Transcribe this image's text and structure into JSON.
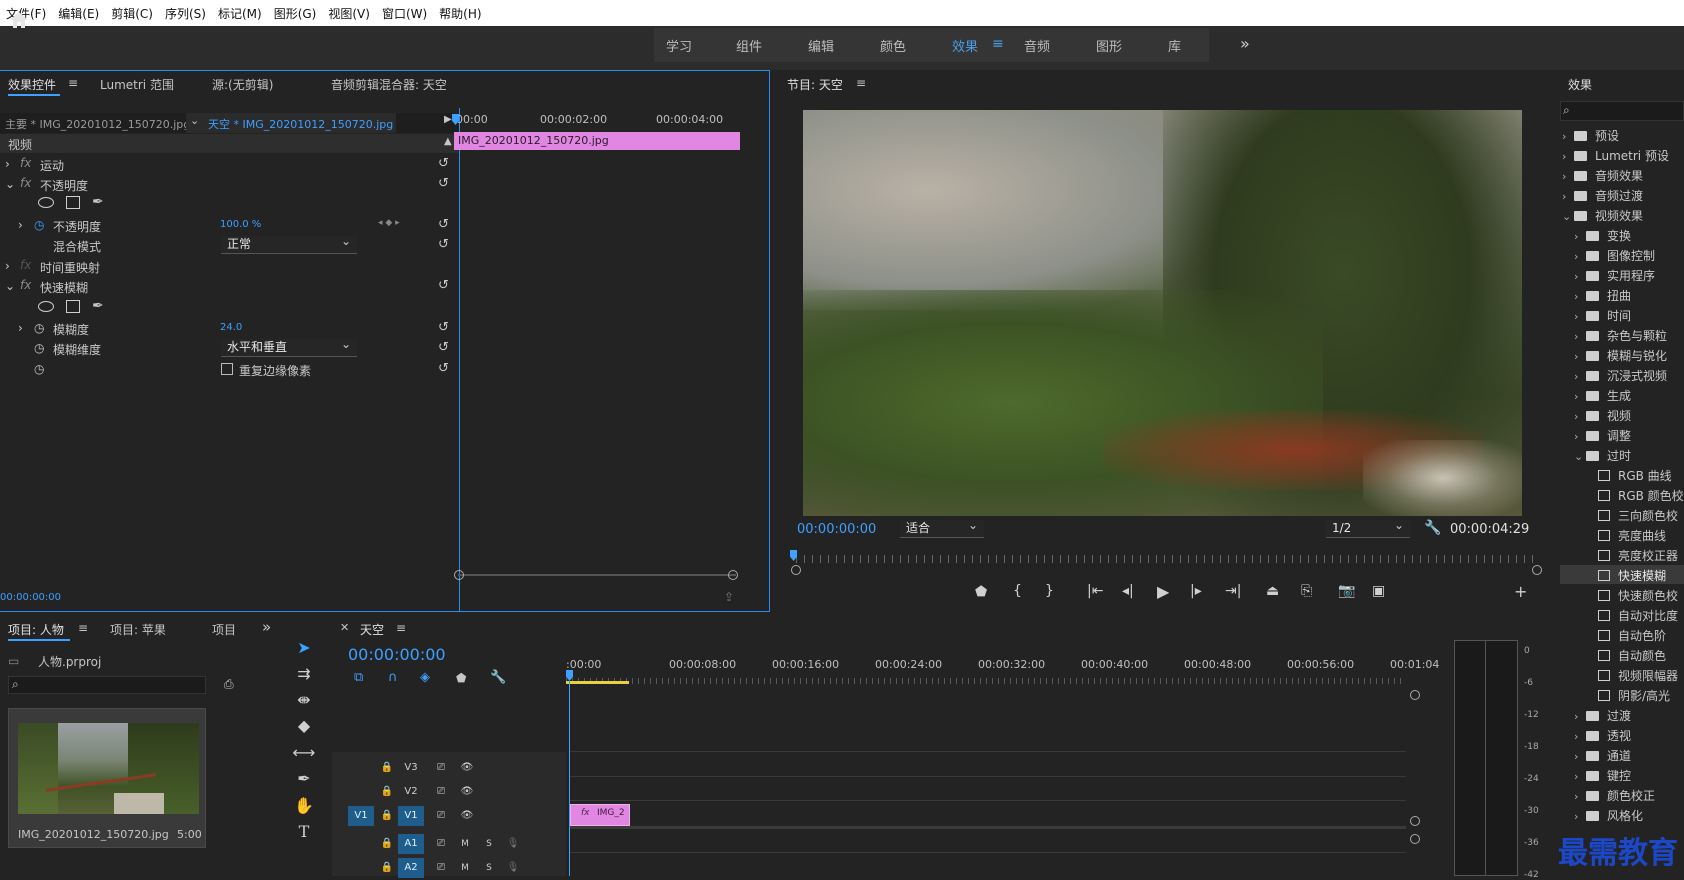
{
  "menu": [
    "文件(F)",
    "编辑(E)",
    "剪辑(C)",
    "序列(S)",
    "标记(M)",
    "图形(G)",
    "视图(V)",
    "窗口(W)",
    "帮助(H)"
  ],
  "workspaces": [
    "学习",
    "组件",
    "编辑",
    "颜色",
    "效果",
    "音频",
    "图形",
    "库"
  ],
  "workspace_active": "效果",
  "effect_controls": {
    "tabs": [
      "效果控件",
      "Lumetri 范围",
      "源:(无剪辑)",
      "音频剪辑混合器: 天空"
    ],
    "master_clip": "主要 * IMG_20201012_150720.jpg",
    "sequence_clip": "天空 * IMG_20201012_150720.jpg",
    "section": "视频",
    "rows": {
      "motion": "运动",
      "opacity": "不透明度",
      "opacity_prop": "不透明度",
      "opacity_value": "100.0 %",
      "blend_mode": "混合模式",
      "blend_value": "正常",
      "time_remap": "时间重映射",
      "fast_blur": "快速模糊",
      "blurriness": "模糊度",
      "blurriness_value": "24.0",
      "blur_dimension": "模糊维度",
      "blur_dimension_value": "水平和垂直",
      "repeat_edge": "重复边缘像素"
    },
    "timecode": "00:00:00:00",
    "mini_ruler": [
      "00:00",
      "00:00:02:00",
      "00:00:04:00"
    ],
    "clip_name": "IMG_20201012_150720.jpg"
  },
  "program": {
    "title": "节目: 天空",
    "timecode": "00:00:00:00",
    "fit": "适合",
    "resolution": "1/2",
    "duration": "00:00:04:29"
  },
  "effects_panel": {
    "title": "效果",
    "items": [
      {
        "label": "预设",
        "level": 0,
        "kind": "folder2",
        "arrow": "›"
      },
      {
        "label": "Lumetri 预设",
        "level": 0,
        "kind": "folder2",
        "arrow": "›"
      },
      {
        "label": "音频效果",
        "level": 0,
        "kind": "folder",
        "arrow": "›"
      },
      {
        "label": "音频过渡",
        "level": 0,
        "kind": "folder",
        "arrow": "›"
      },
      {
        "label": "视频效果",
        "level": 0,
        "kind": "folder",
        "arrow": "⌄"
      },
      {
        "label": "变换",
        "level": 1,
        "kind": "folder",
        "arrow": "›"
      },
      {
        "label": "图像控制",
        "level": 1,
        "kind": "folder",
        "arrow": "›"
      },
      {
        "label": "实用程序",
        "level": 1,
        "kind": "folder",
        "arrow": "›"
      },
      {
        "label": "扭曲",
        "level": 1,
        "kind": "folder",
        "arrow": "›"
      },
      {
        "label": "时间",
        "level": 1,
        "kind": "folder",
        "arrow": "›"
      },
      {
        "label": "杂色与颗粒",
        "level": 1,
        "kind": "folder",
        "arrow": "›"
      },
      {
        "label": "模糊与锐化",
        "level": 1,
        "kind": "folder",
        "arrow": "›"
      },
      {
        "label": "沉浸式视频",
        "level": 1,
        "kind": "folder",
        "arrow": "›"
      },
      {
        "label": "生成",
        "level": 1,
        "kind": "folder",
        "arrow": "›"
      },
      {
        "label": "视频",
        "level": 1,
        "kind": "folder",
        "arrow": "›"
      },
      {
        "label": "调整",
        "level": 1,
        "kind": "folder",
        "arrow": "›"
      },
      {
        "label": "过时",
        "level": 1,
        "kind": "folder",
        "arrow": "⌄"
      },
      {
        "label": "RGB 曲线",
        "level": 2,
        "kind": "preset",
        "arrow": ""
      },
      {
        "label": "RGB 颜色校",
        "level": 2,
        "kind": "preset",
        "arrow": ""
      },
      {
        "label": "三向颜色校",
        "level": 2,
        "kind": "preset",
        "arrow": ""
      },
      {
        "label": "亮度曲线",
        "level": 2,
        "kind": "preset",
        "arrow": ""
      },
      {
        "label": "亮度校正器",
        "level": 2,
        "kind": "preset",
        "arrow": ""
      },
      {
        "label": "快速模糊",
        "level": 2,
        "kind": "preset",
        "arrow": "",
        "selected": true
      },
      {
        "label": "快速颜色校",
        "level": 2,
        "kind": "preset",
        "arrow": ""
      },
      {
        "label": "自动对比度",
        "level": 2,
        "kind": "preset",
        "arrow": ""
      },
      {
        "label": "自动色阶",
        "level": 2,
        "kind": "preset",
        "arrow": ""
      },
      {
        "label": "自动颜色",
        "level": 2,
        "kind": "preset",
        "arrow": ""
      },
      {
        "label": "视频限幅器",
        "level": 2,
        "kind": "preset",
        "arrow": ""
      },
      {
        "label": "阴影/高光",
        "level": 2,
        "kind": "preset",
        "arrow": ""
      },
      {
        "label": "过渡",
        "level": 1,
        "kind": "folder",
        "arrow": "›"
      },
      {
        "label": "透视",
        "level": 1,
        "kind": "folder",
        "arrow": "›"
      },
      {
        "label": "通道",
        "level": 1,
        "kind": "folder",
        "arrow": "›"
      },
      {
        "label": "键控",
        "level": 1,
        "kind": "folder",
        "arrow": "›"
      },
      {
        "label": "颜色校正",
        "level": 1,
        "kind": "folder",
        "arrow": "›"
      },
      {
        "label": "风格化",
        "level": 1,
        "kind": "folder",
        "arrow": "›"
      }
    ]
  },
  "project": {
    "tabs": [
      "项目: 人物",
      "项目: 苹果",
      "项目"
    ],
    "file": "人物.prproj",
    "thumb_name": "IMG_20201012_150720.jpg",
    "thumb_duration": "5:00"
  },
  "timeline": {
    "title": "天空",
    "timecode": "00:00:00:00",
    "ruler": [
      ":00:00",
      "00:00:08:00",
      "00:00:16:00",
      "00:00:24:00",
      "00:00:32:00",
      "00:00:40:00",
      "00:00:48:00",
      "00:00:56:00",
      "00:01:04"
    ],
    "tracks": [
      "V3",
      "V2",
      "V1",
      "A1",
      "A2"
    ],
    "source_patch": "V1",
    "clip_label": "IMG_2",
    "mute": "M",
    "solo": "S"
  },
  "meter_scale": [
    "0",
    "-6",
    "-12",
    "-18",
    "-24",
    "-30",
    "-36",
    "-42"
  ],
  "watermark": "最需教育",
  "colors": {
    "accent": "#3ea0ff",
    "clip_pink": "#e187e2",
    "active_track": "#1f5e8c"
  }
}
